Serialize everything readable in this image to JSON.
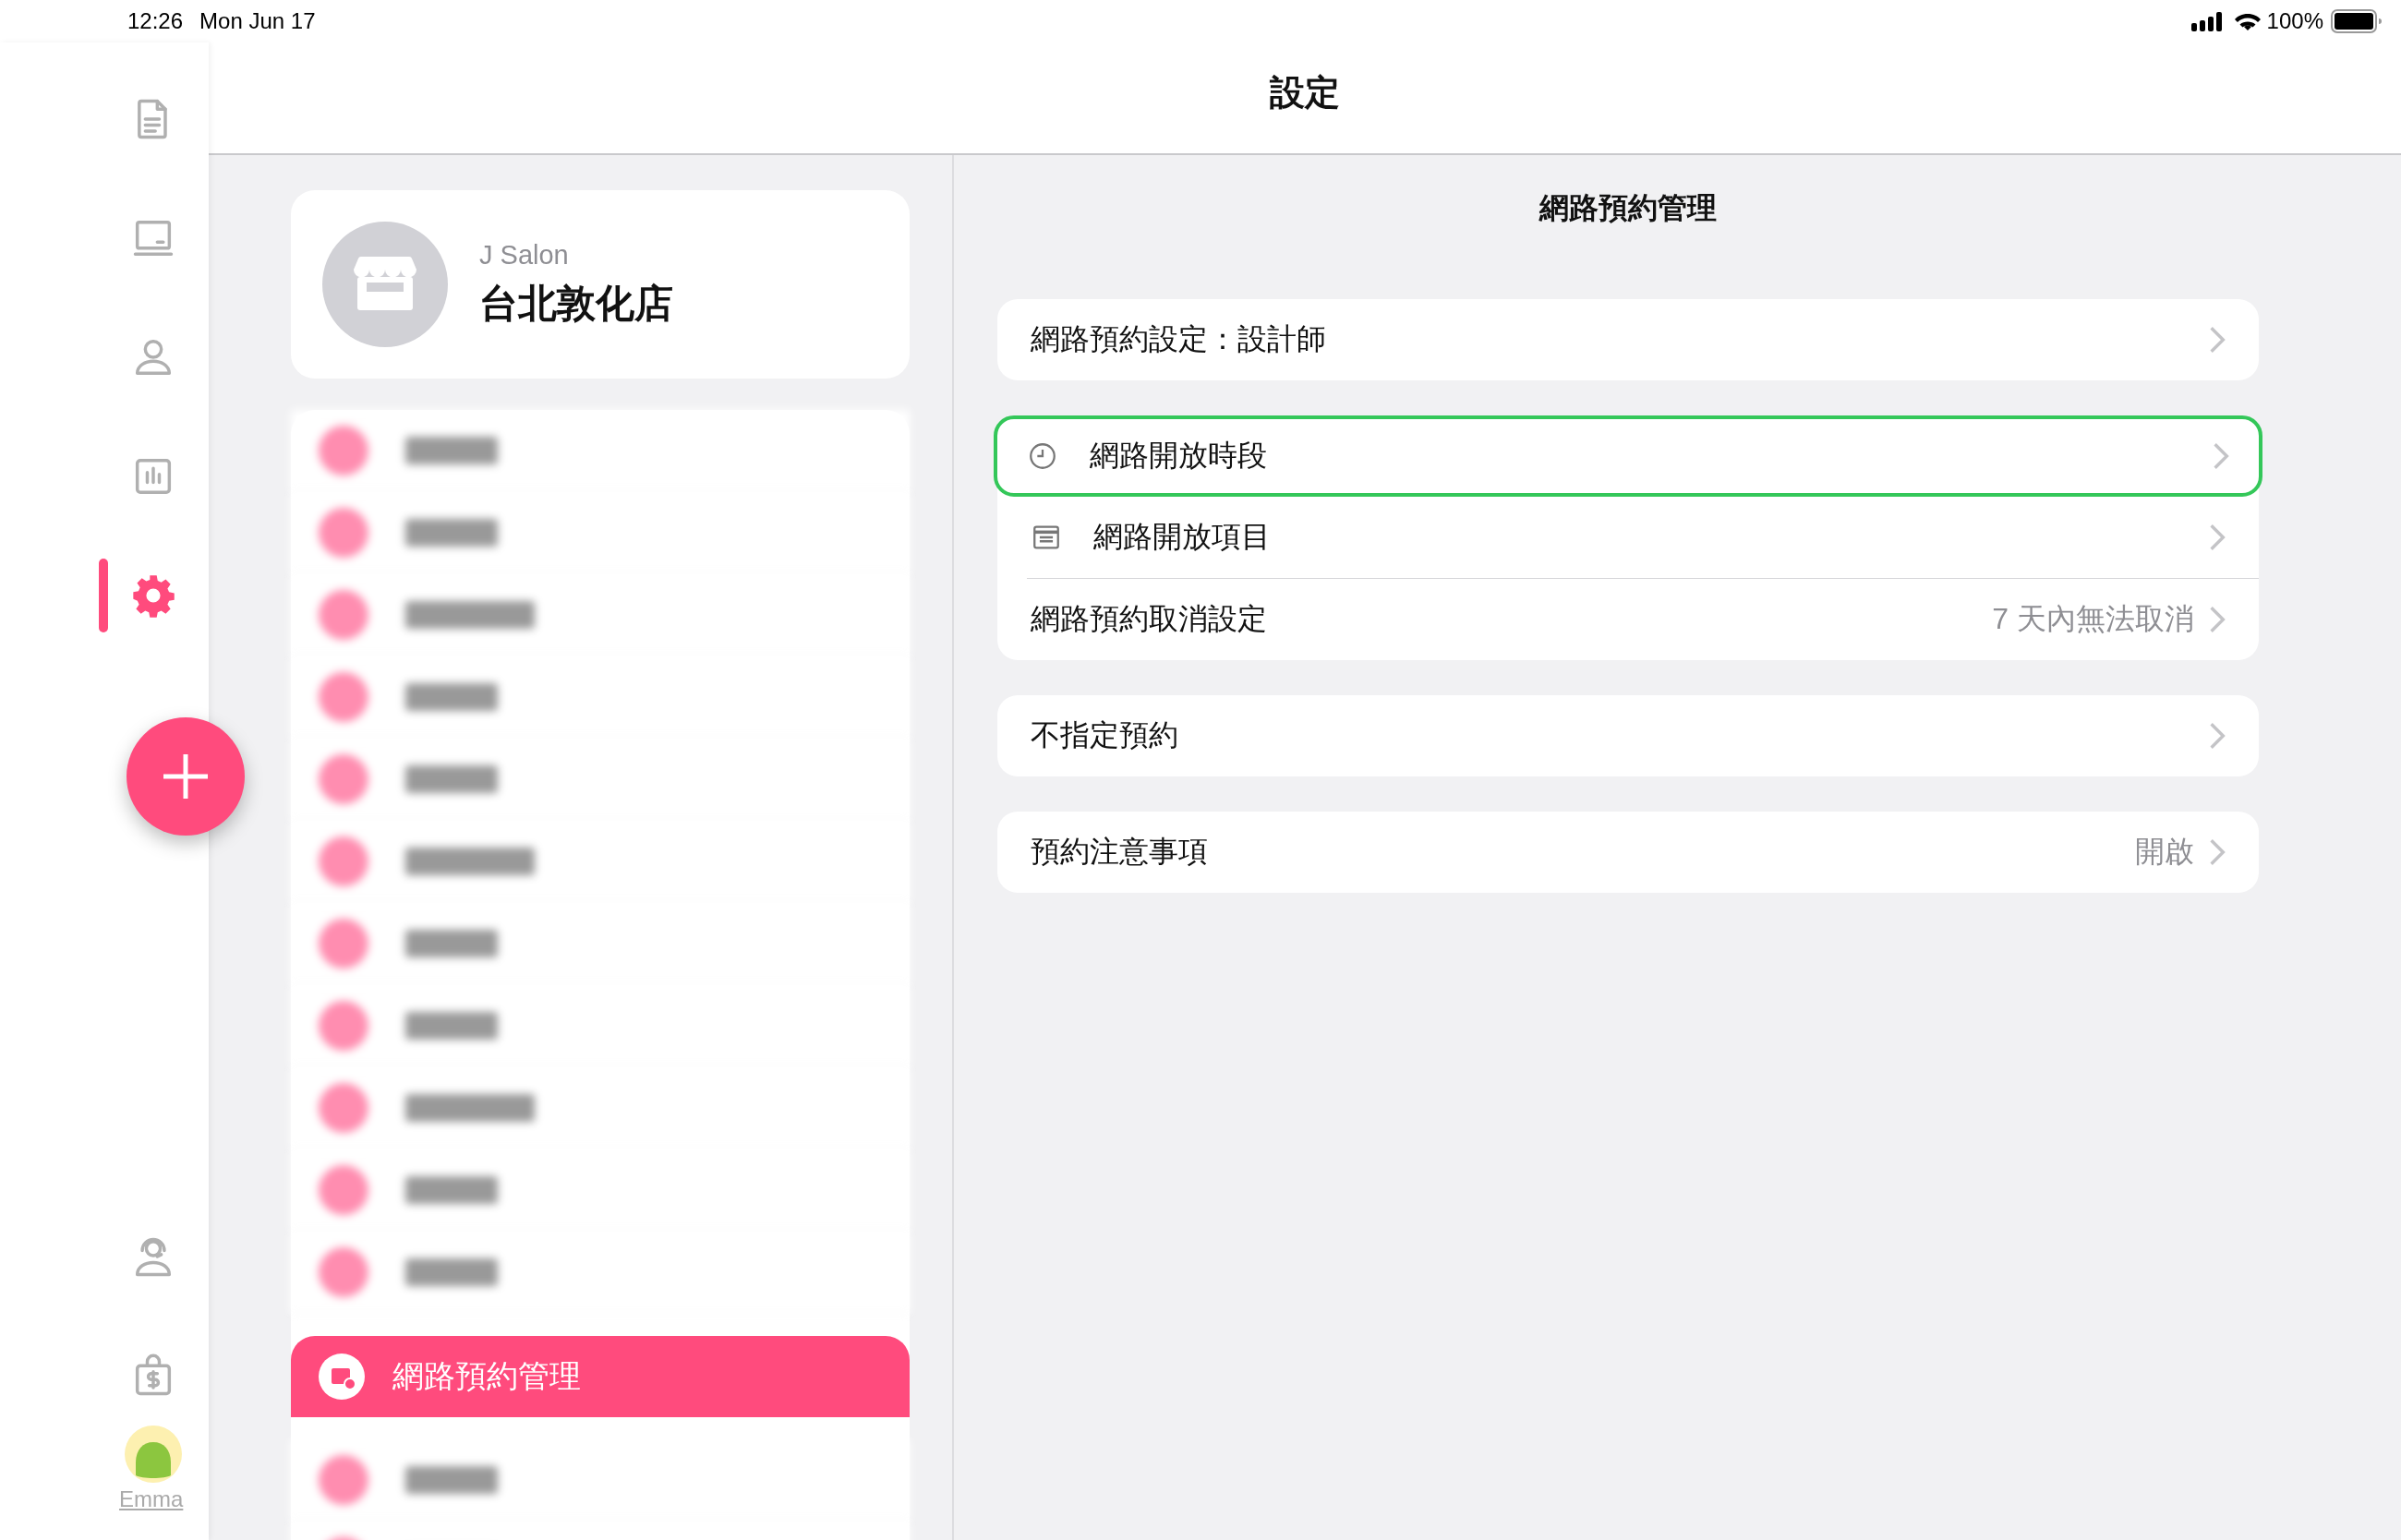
{
  "status_bar": {
    "time": "12:26",
    "date": "Mon Jun 17",
    "battery": "100%"
  },
  "rail": {
    "items": [
      {
        "kind": "document",
        "selected": false
      },
      {
        "kind": "laptop",
        "selected": false
      },
      {
        "kind": "person",
        "selected": false
      },
      {
        "kind": "chart",
        "selected": false
      },
      {
        "kind": "gear",
        "selected": true
      }
    ],
    "bottom_items": [
      {
        "kind": "support"
      },
      {
        "kind": "bag"
      }
    ],
    "user": {
      "name": "Emma"
    }
  },
  "header": {
    "title": "設定"
  },
  "store": {
    "brand": "J Salon",
    "name": "台北敦化店"
  },
  "menu": [
    {
      "kind": "blurred",
      "selected": false
    },
    {
      "kind": "blurred",
      "selected": false
    },
    {
      "kind": "blurred",
      "selected": false
    },
    {
      "kind": "blurred",
      "selected": false
    },
    {
      "kind": "blurred",
      "selected": false
    },
    {
      "kind": "blurred",
      "selected": false
    },
    {
      "kind": "blurred",
      "selected": false
    },
    {
      "kind": "blurred",
      "selected": false
    },
    {
      "kind": "blurred",
      "selected": false
    },
    {
      "kind": "blurred",
      "selected": false
    },
    {
      "kind": "blurred",
      "selected": false
    },
    {
      "kind": "item",
      "label": "網路預約管理",
      "selected": true
    },
    {
      "kind": "blurred",
      "selected": false
    },
    {
      "kind": "blurred",
      "selected": false
    }
  ],
  "detail": {
    "title": "網路預約管理",
    "groups": [
      {
        "rows": [
          {
            "label": "網路預約設定：設計師",
            "highlighted": false
          }
        ]
      },
      {
        "rows": [
          {
            "kind": "clock",
            "label": "網路開放時段",
            "highlighted": true
          },
          {
            "kind": "list",
            "label": "網路開放項目",
            "highlighted": false
          },
          {
            "label": "網路預約取消設定",
            "value": "7 天內無法取消",
            "highlighted": false
          }
        ]
      },
      {
        "rows": [
          {
            "label": "不指定預約",
            "highlighted": false
          }
        ]
      },
      {
        "rows": [
          {
            "label": "預約注意事項",
            "value": "開啟",
            "highlighted": false
          }
        ]
      }
    ]
  }
}
